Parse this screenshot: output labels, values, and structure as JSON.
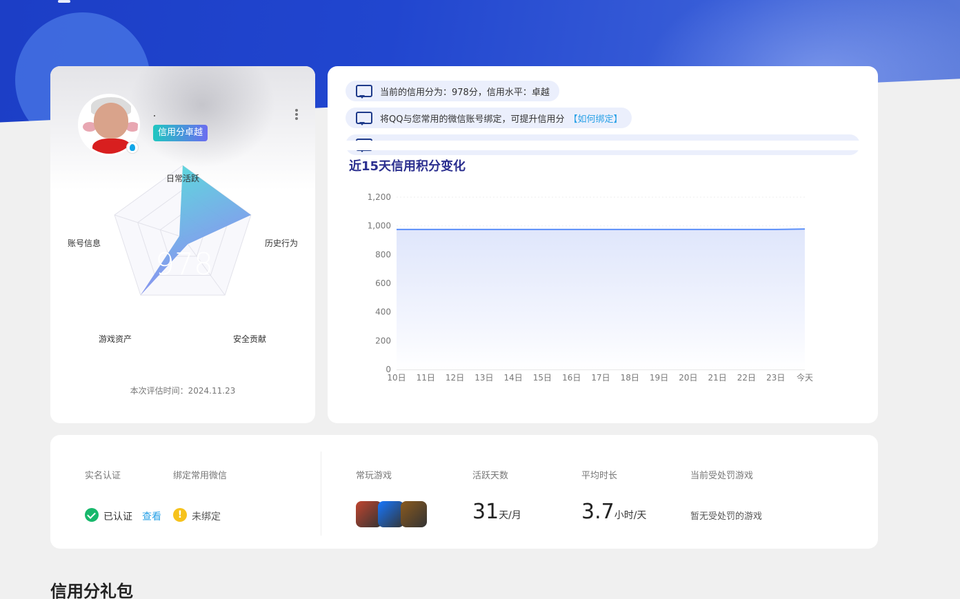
{
  "profile": {
    "level_badge": "信用分卓越",
    "score": "978",
    "radar_labels": {
      "daily_active": "日常活跃",
      "history": "历史行为",
      "security": "安全贡献",
      "game_assets": "游戏资产",
      "account_info": "账号信息"
    },
    "eval_time": "本次评估时间：2024.11.23"
  },
  "notices": [
    {
      "text": "当前的信用分为：978分，信用水平：卓越",
      "link": ""
    },
    {
      "text": "将QQ与您常用的微信账号绑定，可提升信用分",
      "link": "【如何绑定】"
    }
  ],
  "chart_title": "近15天信用积分变化",
  "chart_data": {
    "type": "area",
    "title": "近15天信用积分变化",
    "categories": [
      "10日",
      "11日",
      "12日",
      "13日",
      "14日",
      "15日",
      "16日",
      "17日",
      "18日",
      "19日",
      "20日",
      "21日",
      "22日",
      "23日",
      "今天"
    ],
    "series": [
      {
        "values": [
          975,
          975,
          975,
          975,
          975,
          975,
          975,
          975,
          975,
          975,
          975,
          975,
          975,
          975,
          978
        ]
      }
    ],
    "yticks": [
      "0",
      "200",
      "400",
      "600",
      "800",
      "1,000",
      "1,200"
    ],
    "ylim": [
      0,
      1200
    ],
    "grid": true,
    "line_color": "#5b8ff9",
    "area_top_color": "#dfe6fb"
  },
  "stats": {
    "real_name_label": "实名认证",
    "wechat_label": "绑定常用微信",
    "verified_text": "已认证",
    "view_link": "查看",
    "wechat_status": "未绑定",
    "warn_symbol": "!",
    "games_label": "常玩游戏",
    "games": [
      {
        "icon": "honor-of-kings-icon",
        "color": "#c0452f"
      },
      {
        "icon": "game-controller-icon",
        "color": "#1677ff"
      },
      {
        "icon": "warrior-game-icon",
        "color": "#8a5a1e"
      }
    ],
    "active_days_label": "活跃天数",
    "active_days": "31",
    "active_days_unit": "天/月",
    "avg_time_label": "平均时长",
    "avg_time": "3.7",
    "avg_time_unit": "小时/天",
    "penalty_label": "当前受处罚游戏",
    "penalty_text": "暂无受处罚的游戏"
  },
  "gift_section_title": "信用分礼包"
}
